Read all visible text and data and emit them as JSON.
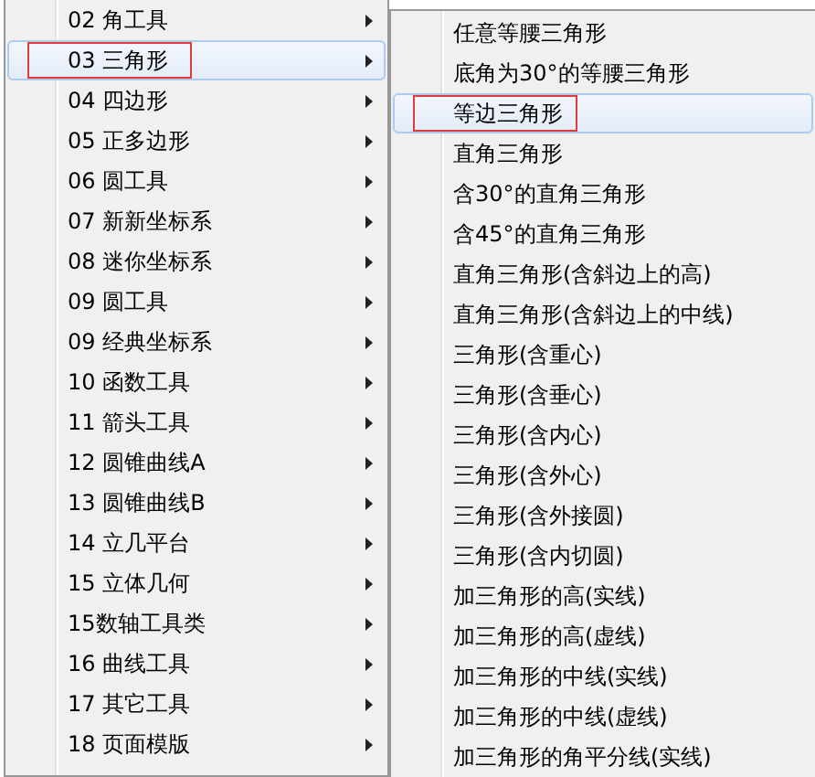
{
  "main_menu": {
    "items": [
      {
        "label": "02 角工具",
        "selected": false,
        "marked": false
      },
      {
        "label": "03 三角形",
        "selected": true,
        "marked": true
      },
      {
        "label": "04 四边形",
        "selected": false,
        "marked": false
      },
      {
        "label": "05 正多边形",
        "selected": false,
        "marked": false
      },
      {
        "label": "06 圆工具",
        "selected": false,
        "marked": false
      },
      {
        "label": "07 新新坐标系",
        "selected": false,
        "marked": false
      },
      {
        "label": "08 迷你坐标系",
        "selected": false,
        "marked": false
      },
      {
        "label": "09 圆工具",
        "selected": false,
        "marked": false
      },
      {
        "label": "09 经典坐标系",
        "selected": false,
        "marked": false
      },
      {
        "label": "10 函数工具",
        "selected": false,
        "marked": false
      },
      {
        "label": "11 箭头工具",
        "selected": false,
        "marked": false
      },
      {
        "label": "12 圆锥曲线A",
        "selected": false,
        "marked": false
      },
      {
        "label": "13 圆锥曲线B",
        "selected": false,
        "marked": false
      },
      {
        "label": "14 立几平台",
        "selected": false,
        "marked": false
      },
      {
        "label": "15 立体几何",
        "selected": false,
        "marked": false
      },
      {
        "label": "15数轴工具类",
        "selected": false,
        "marked": false
      },
      {
        "label": "16 曲线工具",
        "selected": false,
        "marked": false
      },
      {
        "label": "17 其它工具",
        "selected": false,
        "marked": false
      },
      {
        "label": "18 页面模版",
        "selected": false,
        "marked": false
      }
    ]
  },
  "submenu": {
    "items": [
      {
        "label": "任意等腰三角形",
        "selected": false,
        "marked": false
      },
      {
        "label": "底角为30°的等腰三角形",
        "selected": false,
        "marked": false
      },
      {
        "label": "等边三角形",
        "selected": true,
        "marked": true
      },
      {
        "label": "直角三角形",
        "selected": false,
        "marked": false
      },
      {
        "label": "含30°的直角三角形",
        "selected": false,
        "marked": false
      },
      {
        "label": "含45°的直角三角形",
        "selected": false,
        "marked": false
      },
      {
        "label": "直角三角形(含斜边上的高)",
        "selected": false,
        "marked": false
      },
      {
        "label": "直角三角形(含斜边上的中线)",
        "selected": false,
        "marked": false
      },
      {
        "label": "三角形(含重心)",
        "selected": false,
        "marked": false
      },
      {
        "label": "三角形(含垂心)",
        "selected": false,
        "marked": false
      },
      {
        "label": "三角形(含内心)",
        "selected": false,
        "marked": false
      },
      {
        "label": "三角形(含外心)",
        "selected": false,
        "marked": false
      },
      {
        "label": "三角形(含外接圆)",
        "selected": false,
        "marked": false
      },
      {
        "label": "三角形(含内切圆)",
        "selected": false,
        "marked": false
      },
      {
        "label": "加三角形的高(实线)",
        "selected": false,
        "marked": false
      },
      {
        "label": "加三角形的高(虚线)",
        "selected": false,
        "marked": false
      },
      {
        "label": "加三角形的中线(实线)",
        "selected": false,
        "marked": false
      },
      {
        "label": "加三角形的中线(虚线)",
        "selected": false,
        "marked": false
      },
      {
        "label": "加三角形的角平分线(实线)",
        "selected": false,
        "marked": false
      }
    ]
  }
}
